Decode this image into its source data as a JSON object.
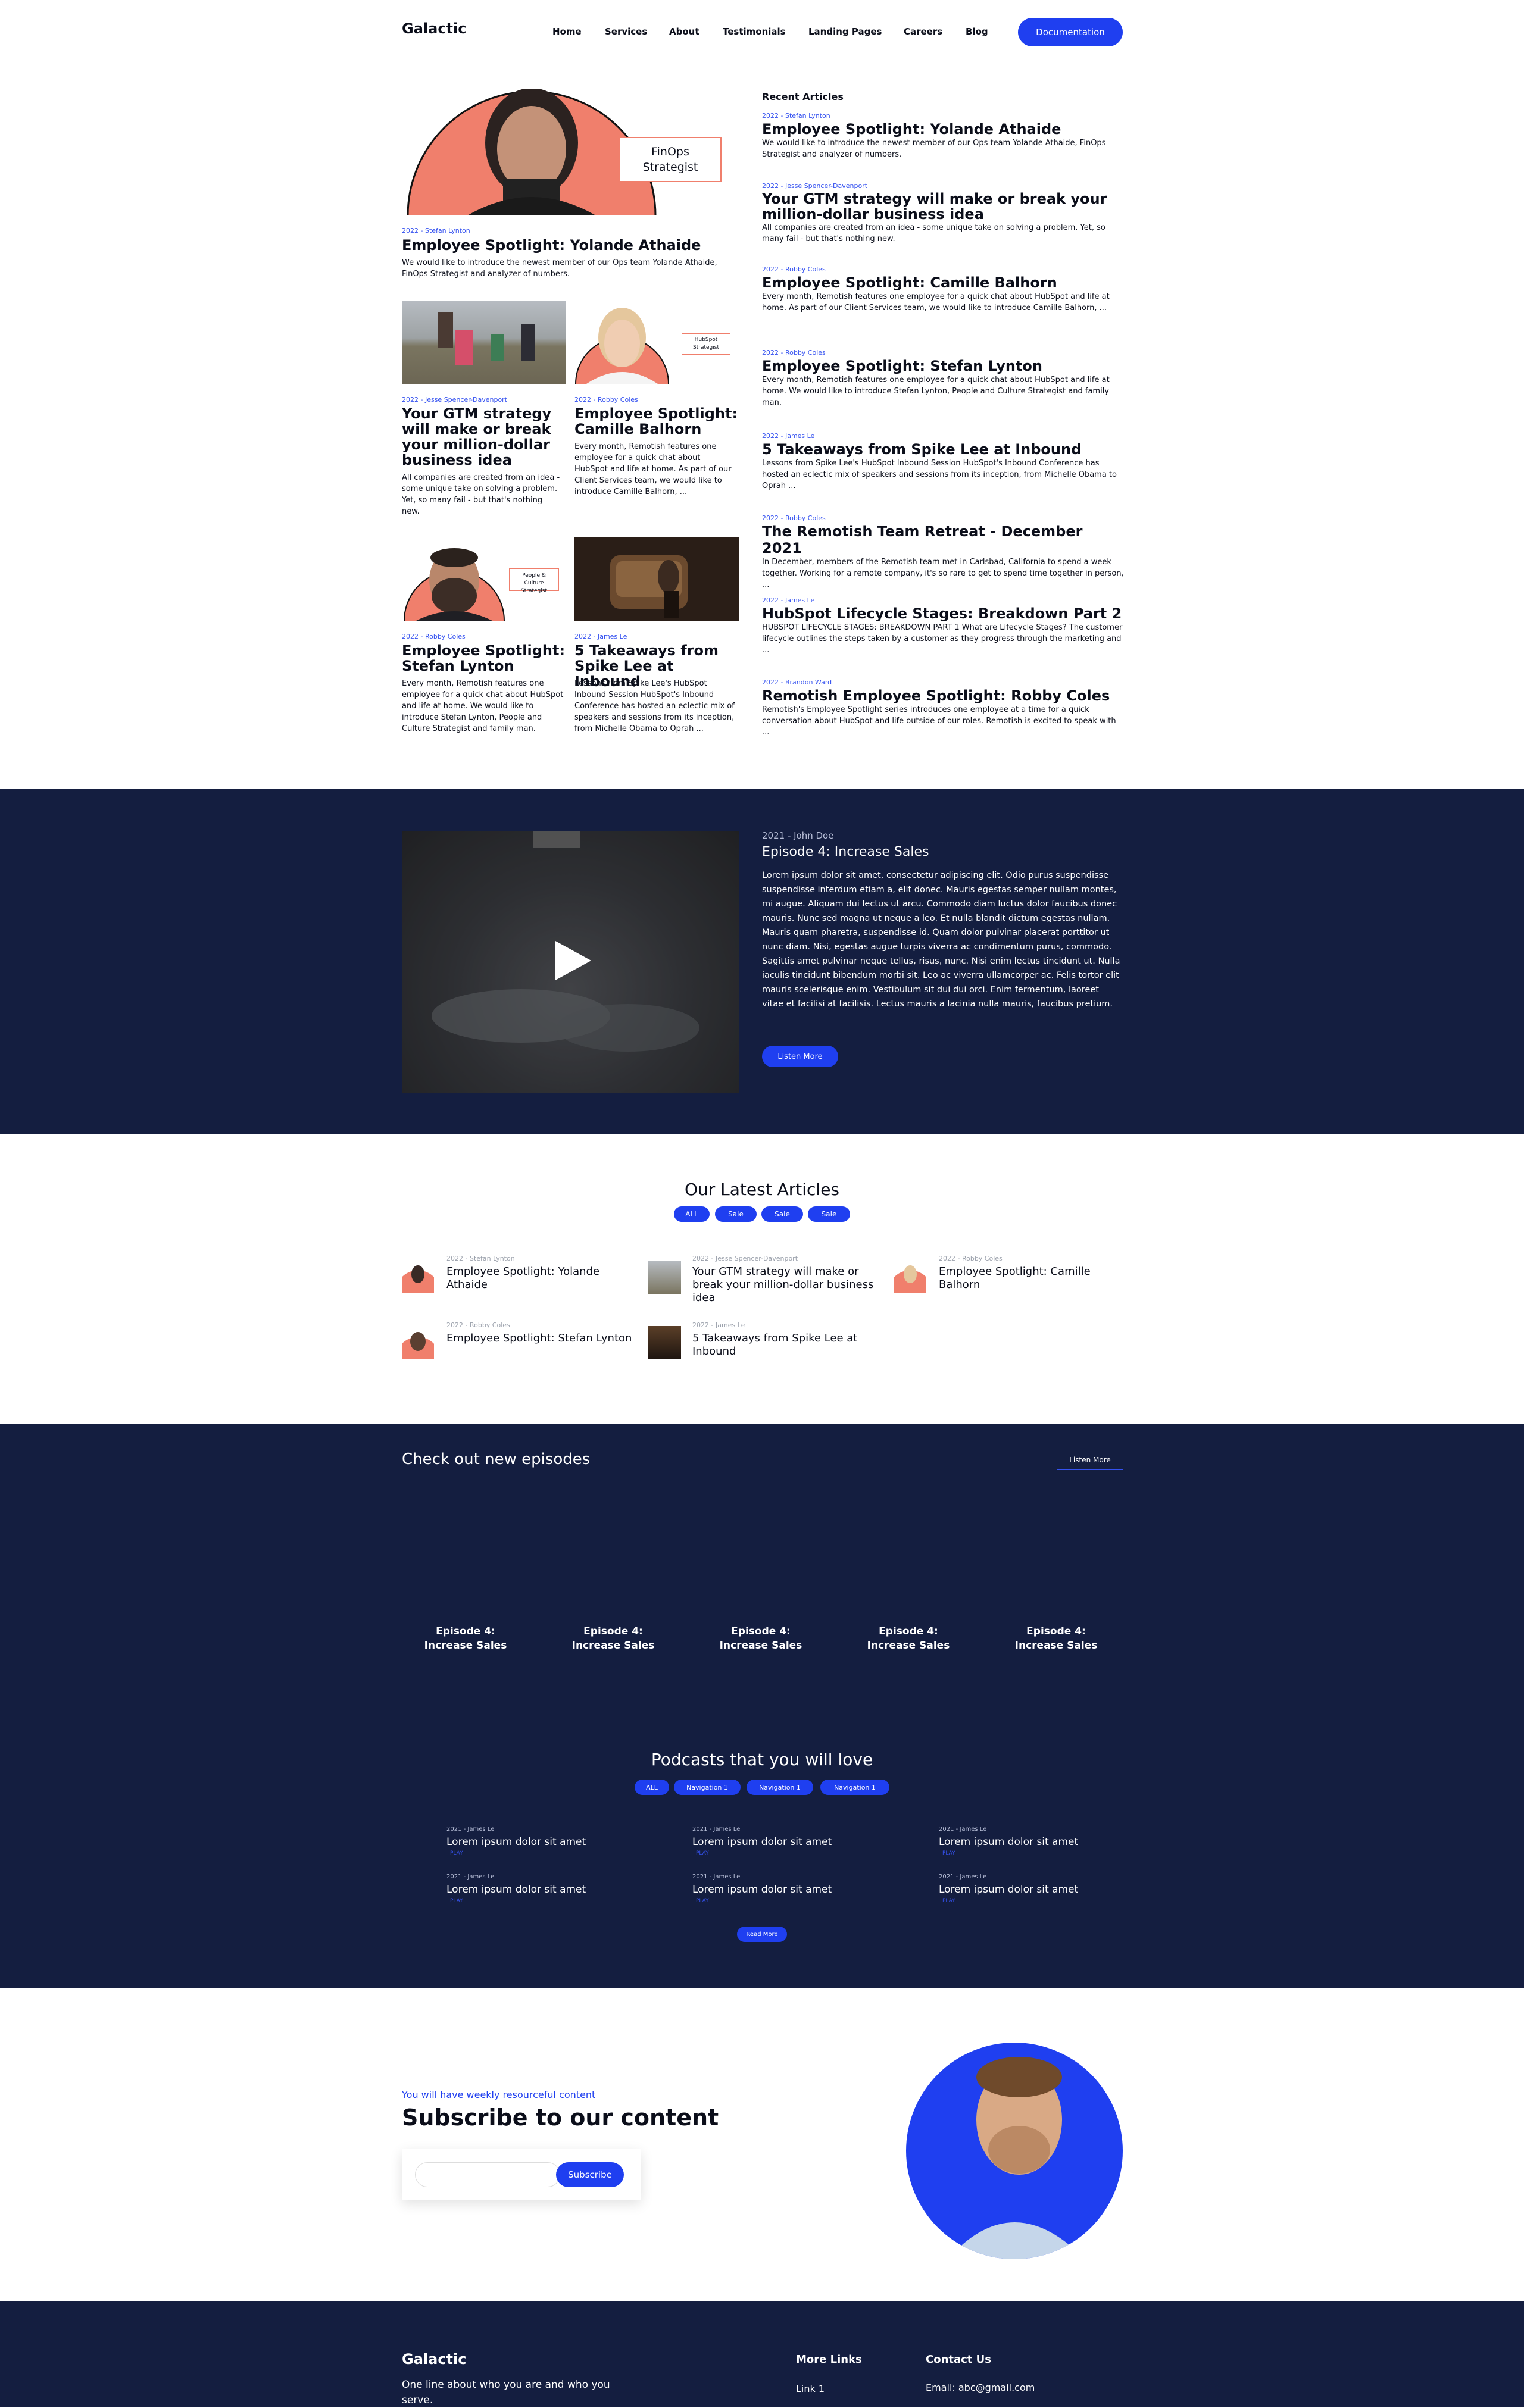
{
  "header": {
    "logo": "Galactic",
    "nav": [
      "Home",
      "Services",
      "About",
      "Testimonials",
      "Landing Pages",
      "Careers",
      "Blog"
    ],
    "cta": "Documentation"
  },
  "featured": {
    "badge": "FinOps Strategist",
    "meta": "2022 - Stefan Lynton",
    "title": "Employee Spotlight: Yolande Athaide",
    "excerpt": "We would like to introduce the newest member of our Ops team Yolande Athaide, FinOps Strategist and analyzer of numbers."
  },
  "grid": [
    {
      "meta": "2022 - Jesse Spencer-Davenport",
      "title": "Your GTM strategy will make or break your million-dollar business idea",
      "excerpt": "All companies are created from an idea - some unique take on solving a problem. Yet, so many fail - but that's nothing new."
    },
    {
      "meta": "2022 - Robby Coles",
      "title": "Employee Spotlight: Camille Balhorn",
      "excerpt": "Every month, Remotish features one employee for a quick chat about HubSpot and life at home. As part of our Client Services team, we would like to introduce Camille Balhorn, ...",
      "badge": "HubSpot Strategist"
    },
    {
      "meta": "2022 - Robby Coles",
      "title": "Employee Spotlight: Stefan Lynton",
      "excerpt": "Every month, Remotish features one employee for a quick chat about HubSpot and life at home. We would like to introduce Stefan Lynton, People and Culture Strategist and family man.",
      "badge": "People & Culture Strategist"
    },
    {
      "meta": "2022 - James Le",
      "title": "5 Takeaways from Spike Lee at Inbound",
      "excerpt": "Lessons from Spike Lee's HubSpot Inbound Session HubSpot's Inbound Conference has hosted an eclectic mix of speakers and sessions from its inception, from Michelle Obama to Oprah ..."
    }
  ],
  "recent": {
    "heading": "Recent Articles",
    "items": [
      {
        "meta": "2022 - Stefan Lynton",
        "title": "Employee Spotlight: Yolande Athaide",
        "excerpt": "We would like to introduce the newest member of our Ops team Yolande Athaide, FinOps Strategist and analyzer of numbers."
      },
      {
        "meta": "2022 - Jesse Spencer-Davenport",
        "title": "Your GTM strategy will make or break your million-dollar business idea",
        "excerpt": "All companies are created from an idea - some unique take on solving a problem. Yet, so many fail - but that's nothing new."
      },
      {
        "meta": "2022 - Robby Coles",
        "title": "Employee Spotlight: Camille Balhorn",
        "excerpt": "Every month, Remotish features one employee for a quick chat about HubSpot and life at home. As part of our Client Services team, we would like to introduce Camille Balhorn, ..."
      },
      {
        "meta": "2022 - Robby Coles",
        "title": "Employee Spotlight: Stefan Lynton",
        "excerpt": "Every month, Remotish features one employee for a quick chat about HubSpot and life at home. We would like to introduce Stefan Lynton, People and Culture Strategist and family man."
      },
      {
        "meta": "2022 - James Le",
        "title": "5 Takeaways from Spike Lee at Inbound",
        "excerpt": "Lessons from Spike Lee's HubSpot Inbound Session HubSpot's Inbound Conference has hosted an eclectic mix of speakers and sessions from its inception, from Michelle Obama to Oprah ..."
      },
      {
        "meta": "2022 - Robby Coles",
        "title": "The Remotish Team Retreat - December 2021",
        "excerpt": "In December, members of the Remotish team met in Carlsbad, California to spend a week together. Working for a remote company, it's so rare to get to spend time together in person, ..."
      },
      {
        "meta": "2022 - James Le",
        "title": "HubSpot Lifecycle Stages: Breakdown Part 2",
        "excerpt": "HUBSPOT LIFECYCLE STAGES: BREAKDOWN PART 1 What are Lifecycle Stages? The customer lifecycle outlines the steps taken by a customer as they progress through the marketing and ..."
      },
      {
        "meta": "2022 - Brandon Ward",
        "title": "Remotish Employee Spotlight: Robby Coles",
        "excerpt": "Remotish's Employee Spotlight series introduces one employee at a time for a quick conversation about HubSpot and life outside of our roles. Remotish is excited to speak with ..."
      }
    ]
  },
  "episode": {
    "meta": "2021 - John Doe",
    "title": "Episode 4: Increase Sales",
    "body": "Lorem ipsum dolor sit amet, consectetur adipiscing elit. Odio purus suspendisse suspendisse interdum etiam a, elit donec. Mauris egestas semper nullam montes, mi augue. Aliquam dui lectus ut arcu. Commodo diam luctus dolor faucibus donec mauris. Nunc sed magna ut neque a leo. Et nulla blandit dictum egestas nullam. Mauris quam pharetra, suspendisse id. Quam dolor pulvinar placerat porttitor ut nunc diam. Nisi, egestas augue turpis viverra ac condimentum purus, commodo. Sagittis amet pulvinar neque tellus, risus, nunc. Nisi enim lectus tincidunt ut. Nulla iaculis tincidunt bibendum morbi sit. Leo ac viverra ullamcorper ac. Felis tortor elit mauris scelerisque enim. Vestibulum sit dui dui orci. Enim fermentum, laoreet vitae et facilisi at facilisis. Lectus mauris a lacinia nulla mauris, faucibus pretium.",
    "button": "Listen More"
  },
  "latest": {
    "heading": "Our Latest Articles",
    "filters": [
      "ALL",
      "Sale",
      "Sale",
      "Sale"
    ],
    "items": [
      {
        "meta": "2022 - Stefan Lynton",
        "title": "Employee Spotlight: Yolande Athaide"
      },
      {
        "meta": "2022 - Jesse Spencer-Davenport",
        "title": "Your GTM strategy will make or break your million-dollar business idea"
      },
      {
        "meta": "2022 - Robby Coles",
        "title": "Employee Spotlight: Camille Balhorn"
      },
      {
        "meta": "2022 - Robby Coles",
        "title": "Employee Spotlight: Stefan Lynton"
      },
      {
        "meta": "2022 - James Le",
        "title": "5 Takeaways from Spike Lee at Inbound"
      }
    ]
  },
  "episodes": {
    "heading": "Check out new episodes",
    "button": "Listen More",
    "cards": [
      "Episode 4: Increase Sales",
      "Episode 4: Increase Sales",
      "Episode 4: Increase Sales",
      "Episode 4: Increase Sales",
      "Episode 4: Increase Sales"
    ]
  },
  "podcasts": {
    "heading": "Podcasts that you will love",
    "filters": [
      "ALL",
      "Navigation 1",
      "Navigation 1",
      "Navigation 1"
    ],
    "items": [
      {
        "meta": "2021 - James Le",
        "title": "Lorem ipsum dolor sit amet",
        "play": "PLAY"
      },
      {
        "meta": "2021 - James Le",
        "title": "Lorem ipsum dolor sit amet",
        "play": "PLAY"
      },
      {
        "meta": "2021 - James Le",
        "title": "Lorem ipsum dolor sit amet",
        "play": "PLAY"
      },
      {
        "meta": "2021 - James Le",
        "title": "Lorem ipsum dolor sit amet",
        "play": "PLAY"
      },
      {
        "meta": "2021 - James Le",
        "title": "Lorem ipsum dolor sit amet",
        "play": "PLAY"
      },
      {
        "meta": "2021 - James Le",
        "title": "Lorem ipsum dolor sit amet",
        "play": "PLAY"
      }
    ],
    "button": "Read More"
  },
  "subscribe": {
    "kicker": "You will have weekly resourceful content",
    "title": "Subscribe to our content",
    "placeholder": "",
    "button": "Subscribe"
  },
  "footer": {
    "logo": "Galactic",
    "tagline": "One line about who you are and who you serve.",
    "links_heading": "More Links",
    "link1": "Link 1",
    "contact_heading": "Contact Us",
    "email": "Email: abc@gmail.com"
  },
  "colors": {
    "accent": "#1f3ff0",
    "navy": "#141e40",
    "salmon": "#f07f6c"
  }
}
